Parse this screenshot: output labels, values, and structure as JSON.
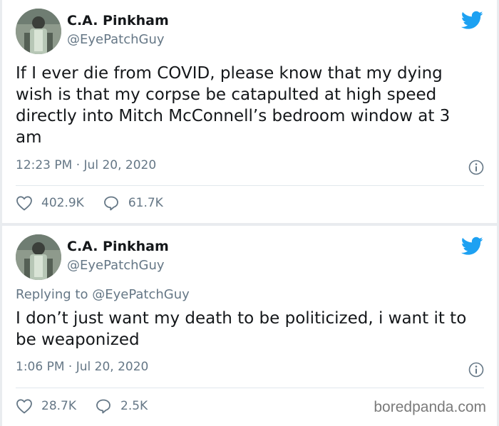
{
  "tweets": [
    {
      "author": {
        "name": "C.A. Pinkham",
        "handle": "@EyePatchGuy"
      },
      "text": "If I ever die from COVID, please know that my dying wish is that my corpse be catapulted at high speed directly into Mitch McConnell’s bedroom window at 3 am",
      "timestamp": "12:23 PM · Jul 20, 2020",
      "likes": "402.9K",
      "replies": "61.7K"
    },
    {
      "author": {
        "name": "C.A. Pinkham",
        "handle": "@EyePatchGuy"
      },
      "replying_prefix": "Replying to",
      "replying_to": "@EyePatchGuy",
      "text": "I don’t just want my death to be politicized, i want it to be weaponized",
      "timestamp": "1:06 PM · Jul 20, 2020",
      "likes": "28.7K",
      "replies": "2.5K"
    }
  ],
  "watermark": "boredpanda.com",
  "colors": {
    "twitter_blue": "#1da1f2",
    "muted_text": "#657786",
    "main_text": "#14171a",
    "divider": "#e1e8ed"
  },
  "icons": [
    "twitter-bird-icon",
    "info-icon",
    "heart-icon",
    "reply-bubble-icon"
  ]
}
